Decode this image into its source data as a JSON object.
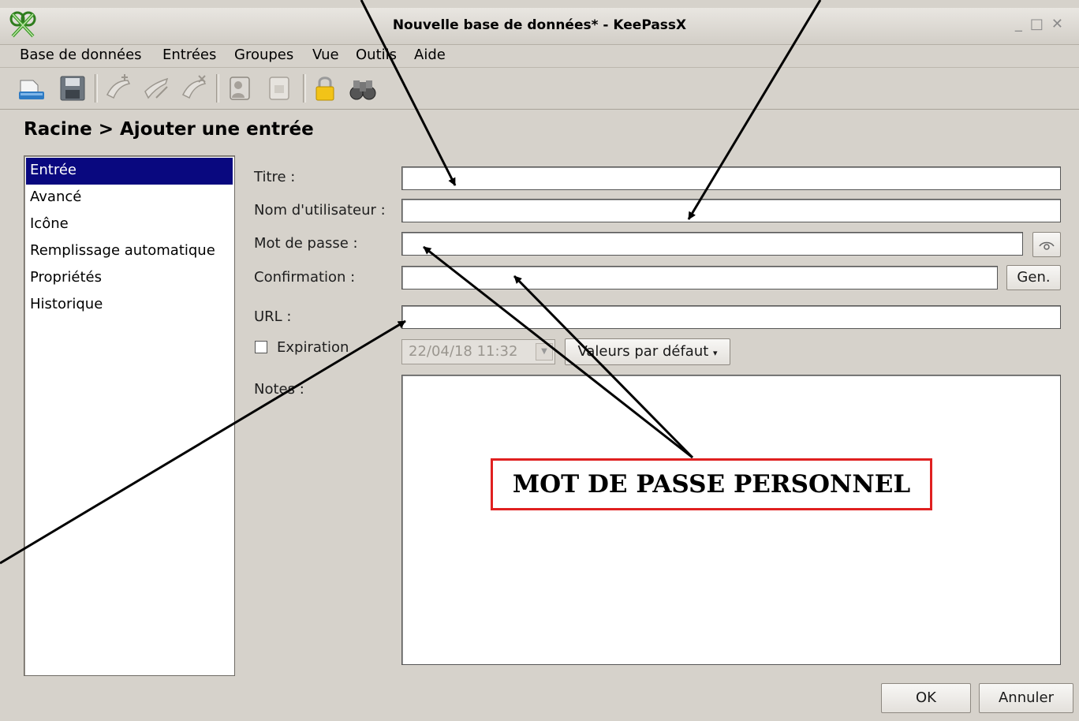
{
  "window": {
    "title": "Nouvelle base de données* - KeePassX",
    "controls": [
      "minimize",
      "maximize",
      "close"
    ]
  },
  "menu": [
    "Base de données",
    "Entrées",
    "Groupes",
    "Vue",
    "Outils",
    "Aide"
  ],
  "toolbar": [
    "new-database-icon",
    "save-icon",
    "add-entry-icon",
    "edit-entry-icon",
    "delete-entry-icon",
    "copy-username-icon",
    "copy-password-icon",
    "lock-icon",
    "search-binoculars-icon"
  ],
  "breadcrumb": "Racine > Ajouter une entrée",
  "nav": [
    {
      "label": "Entrée",
      "selected": true
    },
    {
      "label": "Avancé",
      "selected": false
    },
    {
      "label": "Icône",
      "selected": false
    },
    {
      "label": "Remplissage automatique",
      "selected": false
    },
    {
      "label": "Propriétés",
      "selected": false
    },
    {
      "label": "Historique",
      "selected": false
    }
  ],
  "form": {
    "title_label": "Titre :",
    "title_value": "",
    "username_label": "Nom d'utilisateur :",
    "username_value": "",
    "password_label": "Mot de passe :",
    "password_value": "",
    "confirm_label": "Confirmation :",
    "confirm_value": "",
    "gen_button": "Gen.",
    "url_label": "URL :",
    "url_value": "",
    "expiration_label": "Expiration",
    "expiration_checked": false,
    "expiration_date": "22/04/18 11:32",
    "presets_button": "Valeurs par défaut",
    "notes_label": "Notes :",
    "notes_value": ""
  },
  "buttons": {
    "ok": "OK",
    "cancel": "Annuler"
  },
  "annotation": {
    "text": "MOT DE PASSE PERSONNEL",
    "border_color": "#e02020"
  }
}
